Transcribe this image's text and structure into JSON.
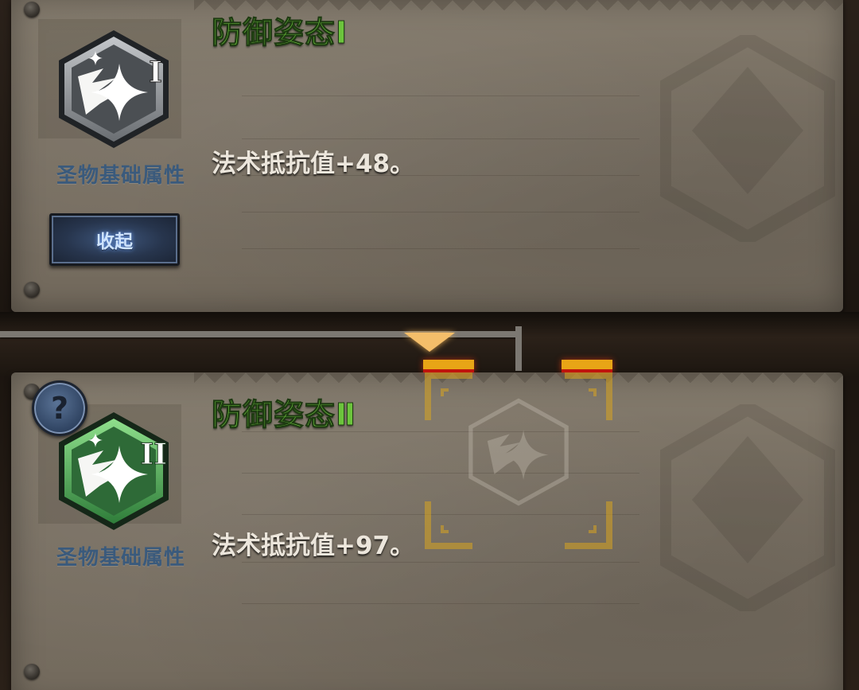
{
  "skills": [
    {
      "title": "防御姿态Ⅰ",
      "level_numeral": "I",
      "category": "圣物基础属性",
      "effect": "法术抵抗值+48。",
      "tier_color": "#8c9094"
    },
    {
      "title": "防御姿态Ⅱ",
      "level_numeral": "II",
      "category": "圣物基础属性",
      "effect": "法术抵抗值+97。",
      "tier_color": "#4aa85a"
    }
  ],
  "buttons": {
    "collapse_label": "收起",
    "help_label": "?"
  },
  "icons": {
    "skill_icon": "sparkle-wing-hexagon-icon",
    "help_icon": "question-icon",
    "marker_icon": "triangle-down-icon"
  },
  "colors": {
    "title_green": "#6cc43c",
    "category_blue": "#3a5a7c",
    "marker_gold": "#f4be6a",
    "slot_red": "#c0140c"
  }
}
